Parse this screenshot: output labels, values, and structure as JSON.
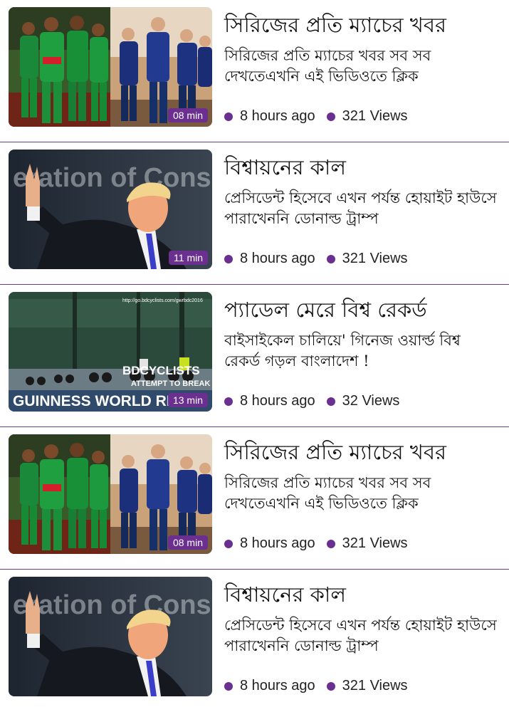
{
  "colors": {
    "accent": "#6a2f8f",
    "divider": "#6a3d8a"
  },
  "items": [
    {
      "thumb": "cricket",
      "duration": "08 min",
      "title": "সিরিজের প্রতি ম্যাচের খবর",
      "desc": "সিরিজের প্রতি ম্যাচের খবর সব সব দেখতেএখনি এই ভিডিওতে ক্লিক",
      "time": "8 hours ago",
      "views": "321 Views"
    },
    {
      "thumb": "politician",
      "duration": "11 min",
      "title": "বিশ্বায়নের কাল",
      "desc": "প্রেসিডেন্ট হিসেবে এখন পর্যন্ত হোয়াইট হাউসে পারাখেননি ডোনাল্ড ট্রাম্প",
      "time": "8 hours ago",
      "views": "321 Views",
      "thumb_text": "eration of Conse"
    },
    {
      "thumb": "cycling",
      "duration": "13 min",
      "title": "প্যাডেল মেরে বিশ্ব রেকর্ড",
      "desc": "বাইসাইকেল চালিয়ে' গিনেজ ওয়ার্ল্ড বিশ্ব রেকর্ড গড়ল বাংলাদেশ !",
      "time": "8 hours ago",
      "views": "32 Views",
      "thumb_url": "http://go.bdcyclists.com/gwrbdc2016",
      "thumb_line1": "BDCYCLISTS",
      "thumb_line2": "ATTEMPT TO BREAK",
      "thumb_line3": "GUINNESS WORLD RE"
    },
    {
      "thumb": "cricket",
      "duration": "08 min",
      "title": "সিরিজের প্রতি ম্যাচের খবর",
      "desc": "সিরিজের প্রতি ম্যাচের খবর সব সব দেখতেএখনি এই ভিডিওতে ক্লিক",
      "time": "8 hours ago",
      "views": "321 Views"
    },
    {
      "thumb": "politician",
      "duration": "",
      "title": "বিশ্বায়নের কাল",
      "desc": "প্রেসিডেন্ট হিসেবে এখন পর্যন্ত হোয়াইট হাউসে পারাখেননি ডোনাল্ড ট্রাম্প",
      "time": "8 hours ago",
      "views": "321 Views",
      "thumb_text": "eration of Conse"
    }
  ]
}
